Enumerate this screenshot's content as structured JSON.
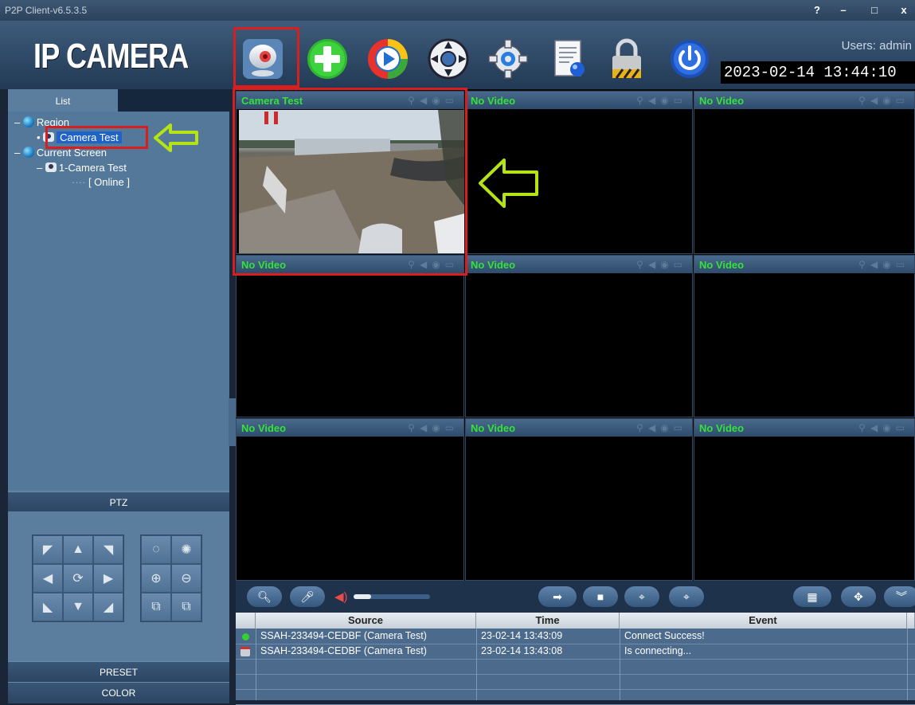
{
  "window": {
    "title": "P2P Client-v6.5.3.5",
    "controls": [
      "?",
      "–",
      "□",
      "x"
    ]
  },
  "header": {
    "logo": "IP CAMERA",
    "users": "Users: admin",
    "datetime": "2023-02-14  13:44:10",
    "toolbar_icons": [
      "webcam-icon",
      "add-icon",
      "playback-icon",
      "ptz-wheel-icon",
      "settings-icon",
      "log-icon",
      "lock-icon",
      "power-icon"
    ]
  },
  "sidebar": {
    "list_tab": "List",
    "tree": {
      "region": "Region",
      "camera_test": "Camera Test",
      "current_screen": "Current Screen",
      "camera_item": "1-Camera Test",
      "status": "[   Online   ]"
    },
    "ptz_label": "PTZ",
    "preset_label": "PRESET",
    "color_label": "COLOR"
  },
  "grid": {
    "cells": [
      {
        "name": "Camera Test",
        "active": true
      },
      {
        "name": "No Video"
      },
      {
        "name": "No Video"
      },
      {
        "name": "No Video"
      },
      {
        "name": "No Video"
      },
      {
        "name": "No Video"
      },
      {
        "name": "No Video"
      },
      {
        "name": "No Video"
      },
      {
        "name": "No Video"
      }
    ]
  },
  "events": {
    "columns": [
      "Source",
      "Time",
      "Event"
    ],
    "rows": [
      {
        "status": "connected",
        "source": "SSAH-233494-CEDBF (Camera Test)",
        "time": "23-02-14 13:43:09",
        "event": "Connect Success!"
      },
      {
        "status": "connecting",
        "source": "SSAH-233494-CEDBF (Camera Test)",
        "time": "23-02-14 13:43:08",
        "event": "Is connecting..."
      }
    ]
  },
  "colors": {
    "accent_red": "#d81e1e",
    "video_label_green": "#35e23a",
    "annotation_arrow": "#b6e314"
  }
}
